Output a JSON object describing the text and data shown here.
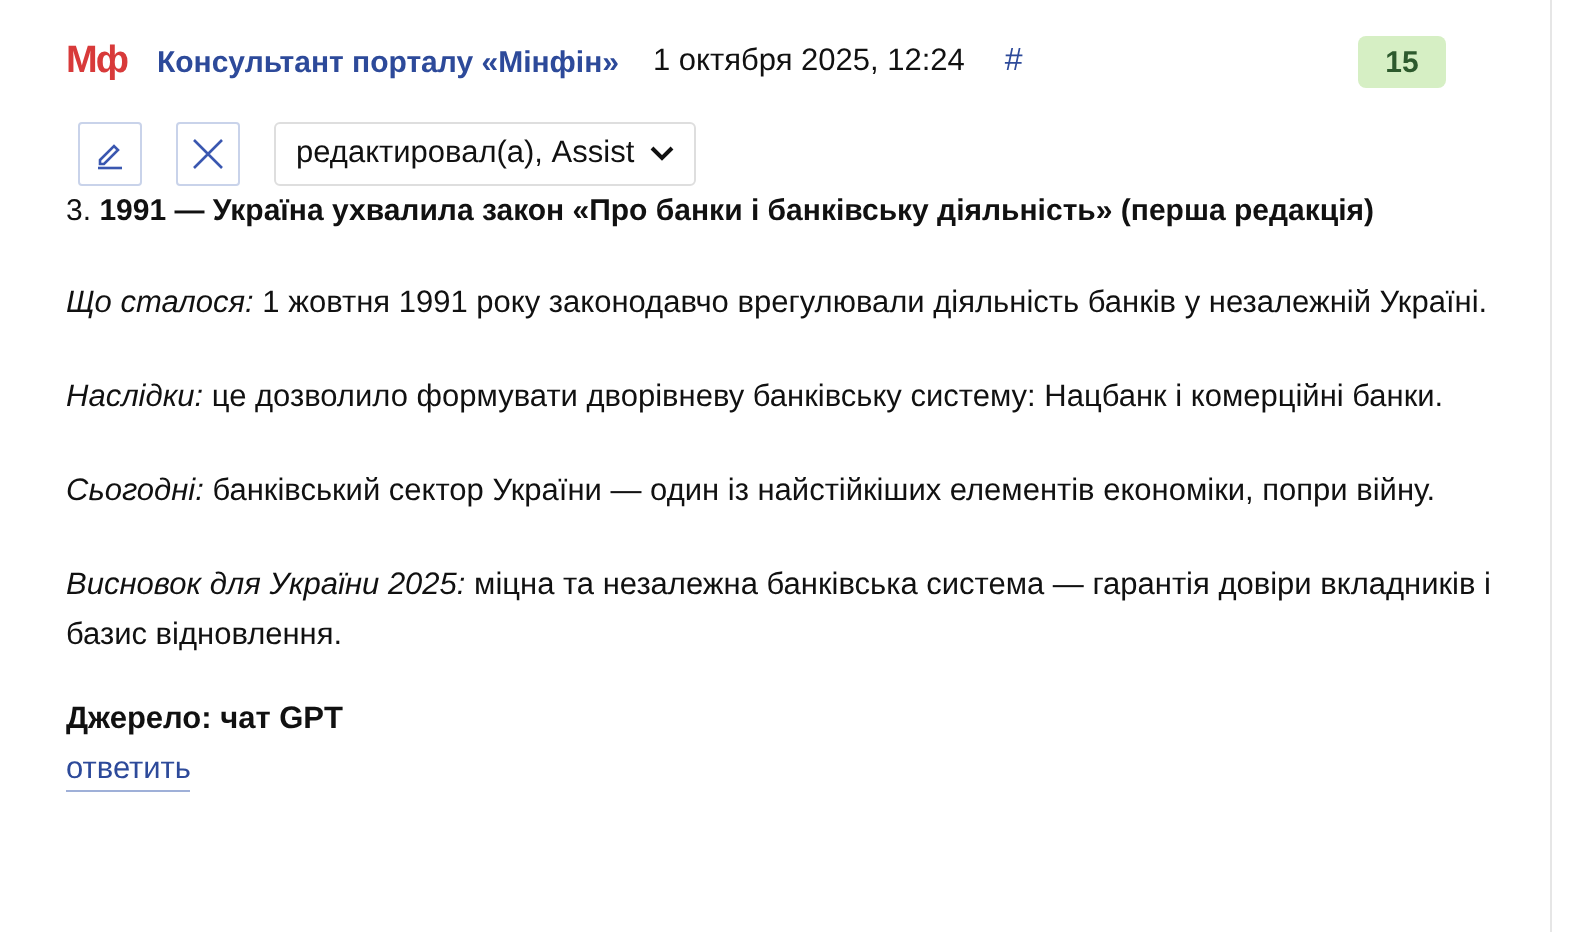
{
  "header": {
    "logo": "Мф",
    "author": "Консультант порталу «Мінфін»",
    "date": "1 октября 2025, 12:24",
    "anchor": "#",
    "rating": "15"
  },
  "toolbar": {
    "edit_history": "редактировал(а), Assist"
  },
  "post": {
    "title": "3. **1991 — Україна ухвалила закон «Про банки і банківську діяльність» (перша редакція)**",
    "paragraphs": [
      "*Що сталося:* 1 жовтня 1991 року законодавчо врегулювали діяльність банків у незалежній Україні.",
      "*Наслідки:* це дозволило формувати дворівневу банківську систему: Нацбанк і комерційні банки.",
      "*Сьогодні:* банківський сектор України — один із найстійкіших елементів економіки, попри війну.",
      "*Висновок для України 2025:* міцна та незалежна банківська система — гарантія довіри вкладників і базис відновлення."
    ],
    "source": "Джерело: чат GPT"
  },
  "reply_link": "ответить"
}
